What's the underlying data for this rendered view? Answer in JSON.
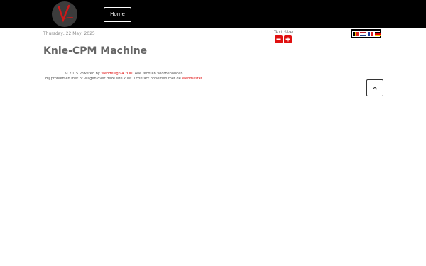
{
  "header": {
    "home_label": "Home"
  },
  "date": "Thursday, 22 May, 2025",
  "text_size": {
    "label": "Text Size"
  },
  "languages": [
    "Belgian",
    "Dutch",
    "French",
    "German"
  ],
  "page_title": "Knie-CPM Machine",
  "footer": {
    "line1_prefix": "© 2015 Powered by ",
    "line1_link": "Webdesign 4 YOU",
    "line1_suffix": ". Alle rechten voorbehouden.",
    "line2_prefix": "Bij problemen met of vragen over deze site kunt u contact opnemen met de ",
    "line2_link": "Webmaster",
    "line2_suffix": "."
  },
  "colors": {
    "accent": "#e01010",
    "topbar": "#000000"
  }
}
